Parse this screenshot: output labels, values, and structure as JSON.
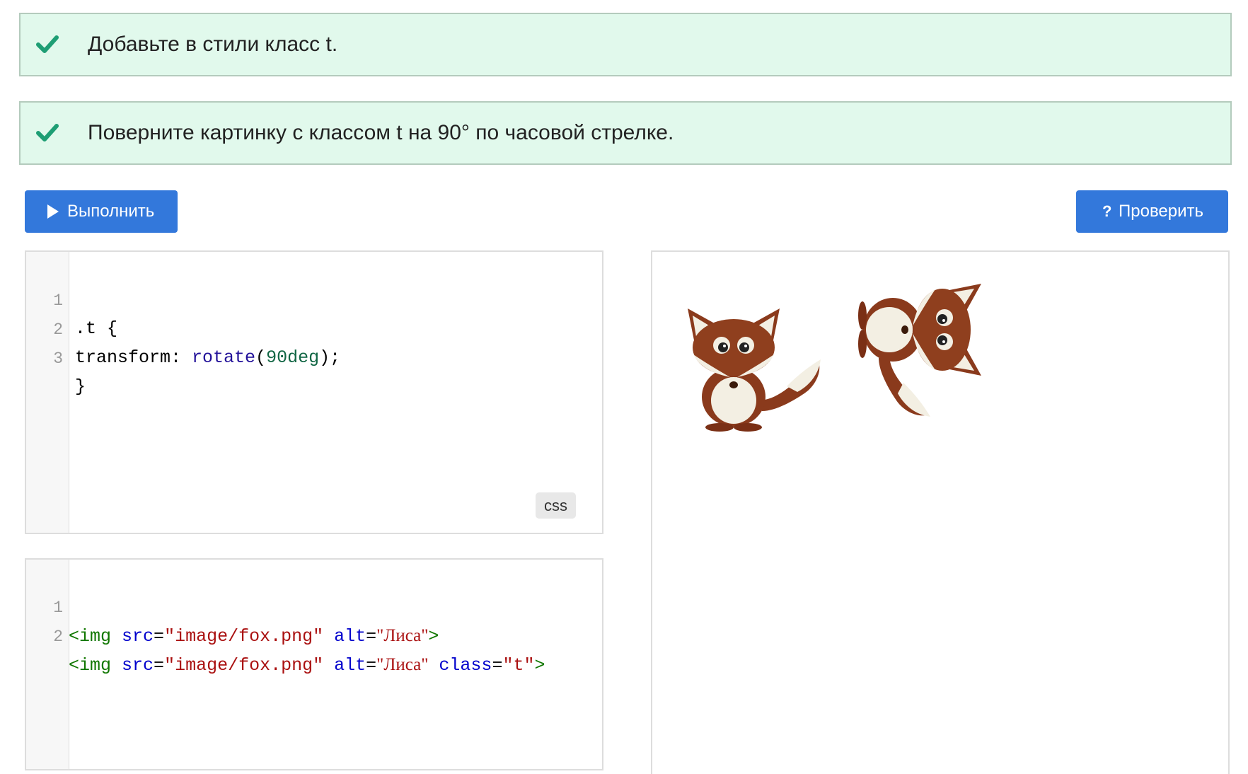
{
  "tasks": [
    {
      "status": "completed",
      "icon": "check-icon",
      "text": "Добавьте в стили класс t."
    },
    {
      "status": "completed",
      "icon": "check-icon",
      "text": "Поверните картинку с классом t на 90° по часовой стрелке."
    }
  ],
  "toolbar": {
    "run_label": "Выполнить",
    "run_icon": "play-icon",
    "check_label": "Проверить",
    "check_icon_glyph": "?",
    "button_color": "#3378db"
  },
  "css_editor": {
    "language_badge": "css",
    "line_numbers": [
      "1",
      "2",
      "3"
    ],
    "line1": ".t {",
    "line2": {
      "prop": "transform: ",
      "func": "rotate",
      "open": "(",
      "num": "90deg",
      "close": ");"
    },
    "line3": "}"
  },
  "html_editor": {
    "line_numbers": [
      "1",
      "2"
    ],
    "line1": {
      "tag_open": "<img",
      "attr_src": "src",
      "eq": "=",
      "src": "\"image/fox.png\"",
      "attr_alt": "alt",
      "alt": "\"Лиса\"",
      "tag_close": ">"
    },
    "line2": {
      "tag_open": "<img",
      "attr_src": "src",
      "eq": "=",
      "src": "\"image/fox.png\"",
      "attr_alt": "alt",
      "alt": "\"Лиса\"",
      "attr_class": "class",
      "class": "\"t\"",
      "tag_close": ">"
    }
  },
  "preview": {
    "images": [
      {
        "alt": "Лиса",
        "rotation_deg": 0
      },
      {
        "alt": "Лиса",
        "rotation_deg": 90
      }
    ]
  },
  "colors": {
    "task_bg": "#e1f9ec",
    "task_border": "#b4cbbd",
    "check_green": "#1e9e74"
  }
}
